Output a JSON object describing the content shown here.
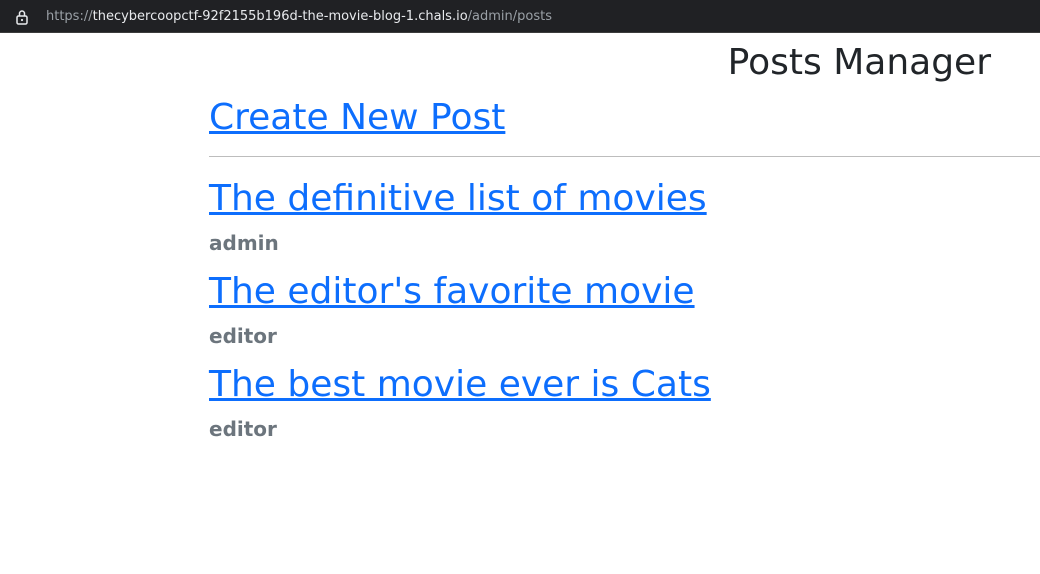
{
  "browser": {
    "url_scheme": "https://",
    "url_host": "thecybercoopctf-92f2155b196d-the-movie-blog-1.chals.io",
    "url_path": "/admin/posts"
  },
  "page": {
    "title": "Posts Manager",
    "create_link": "Create New Post"
  },
  "posts": [
    {
      "title": "The definitive list of movies",
      "author": "admin"
    },
    {
      "title": "The editor's favorite movie",
      "author": "editor"
    },
    {
      "title": "The best movie ever is Cats",
      "author": "editor"
    }
  ],
  "colors": {
    "link": "#0d6efd",
    "author": "#6c757d",
    "heading": "#212529",
    "urlbar_bg": "#202124"
  }
}
